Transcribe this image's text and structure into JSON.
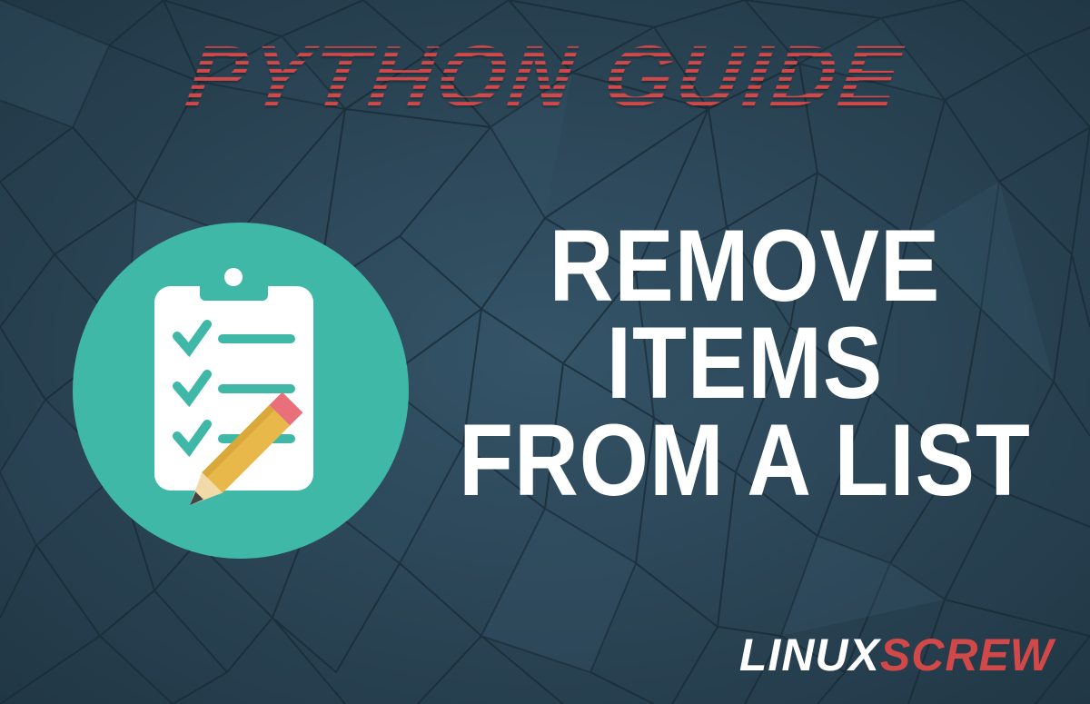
{
  "header": {
    "kicker": "PYTHON GUIDE"
  },
  "main": {
    "heading_line1": "REMOVE ITEMS",
    "heading_line2": "FROM A LIST"
  },
  "logo": {
    "part1": "LINUX",
    "part2": "SCREW"
  },
  "icon": {
    "name": "checklist-with-pencil"
  },
  "colors": {
    "bg": "#2a4555",
    "accent_red": "#d14848",
    "accent_teal": "#3fb8a8",
    "white": "#ffffff"
  }
}
